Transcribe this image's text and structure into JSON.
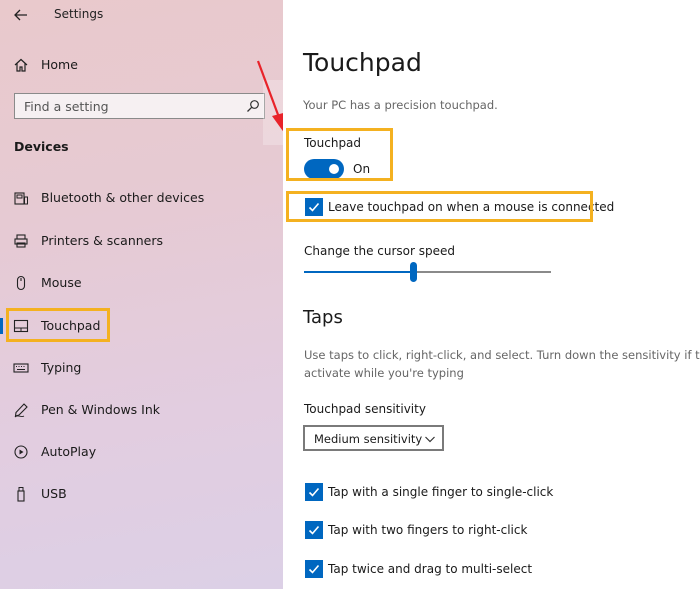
{
  "app": {
    "title": "Settings"
  },
  "sidebar": {
    "home_label": "Home",
    "search": {
      "placeholder": "Find a setting"
    },
    "section_title": "Devices",
    "items": [
      {
        "label": "Bluetooth & other devices",
        "icon": "bluetooth-devices-icon"
      },
      {
        "label": "Printers & scanners",
        "icon": "printer-icon"
      },
      {
        "label": "Mouse",
        "icon": "mouse-icon"
      },
      {
        "label": "Touchpad",
        "icon": "touchpad-icon",
        "selected": true
      },
      {
        "label": "Typing",
        "icon": "keyboard-icon"
      },
      {
        "label": "Pen & Windows Ink",
        "icon": "pen-icon"
      },
      {
        "label": "AutoPlay",
        "icon": "autoplay-icon"
      },
      {
        "label": "USB",
        "icon": "usb-icon"
      }
    ]
  },
  "main": {
    "title": "Touchpad",
    "subtitle": "Your PC has a precision touchpad.",
    "touchpad_toggle": {
      "label": "Touchpad",
      "state": "On",
      "on": true
    },
    "leave_on_checkbox": {
      "label": "Leave touchpad on when a mouse is connected",
      "checked": true
    },
    "cursor_speed": {
      "label": "Change the cursor speed",
      "value_fraction": 0.44
    },
    "taps": {
      "heading": "Taps",
      "description_line1": "Use taps to click, right-click, and select. Turn down the sensitivity if they",
      "description_line2": "activate while you're typing",
      "sensitivity_label": "Touchpad sensitivity",
      "sensitivity_value": "Medium sensitivity",
      "options": [
        {
          "label": "Tap with a single finger to single-click",
          "checked": true
        },
        {
          "label": "Tap with two fingers to right-click",
          "checked": true
        },
        {
          "label": "Tap twice and drag to multi-select",
          "checked": true
        }
      ]
    }
  },
  "colors": {
    "accent": "#0067c0",
    "highlight": "#f4b120",
    "arrow": "#e8232a"
  }
}
